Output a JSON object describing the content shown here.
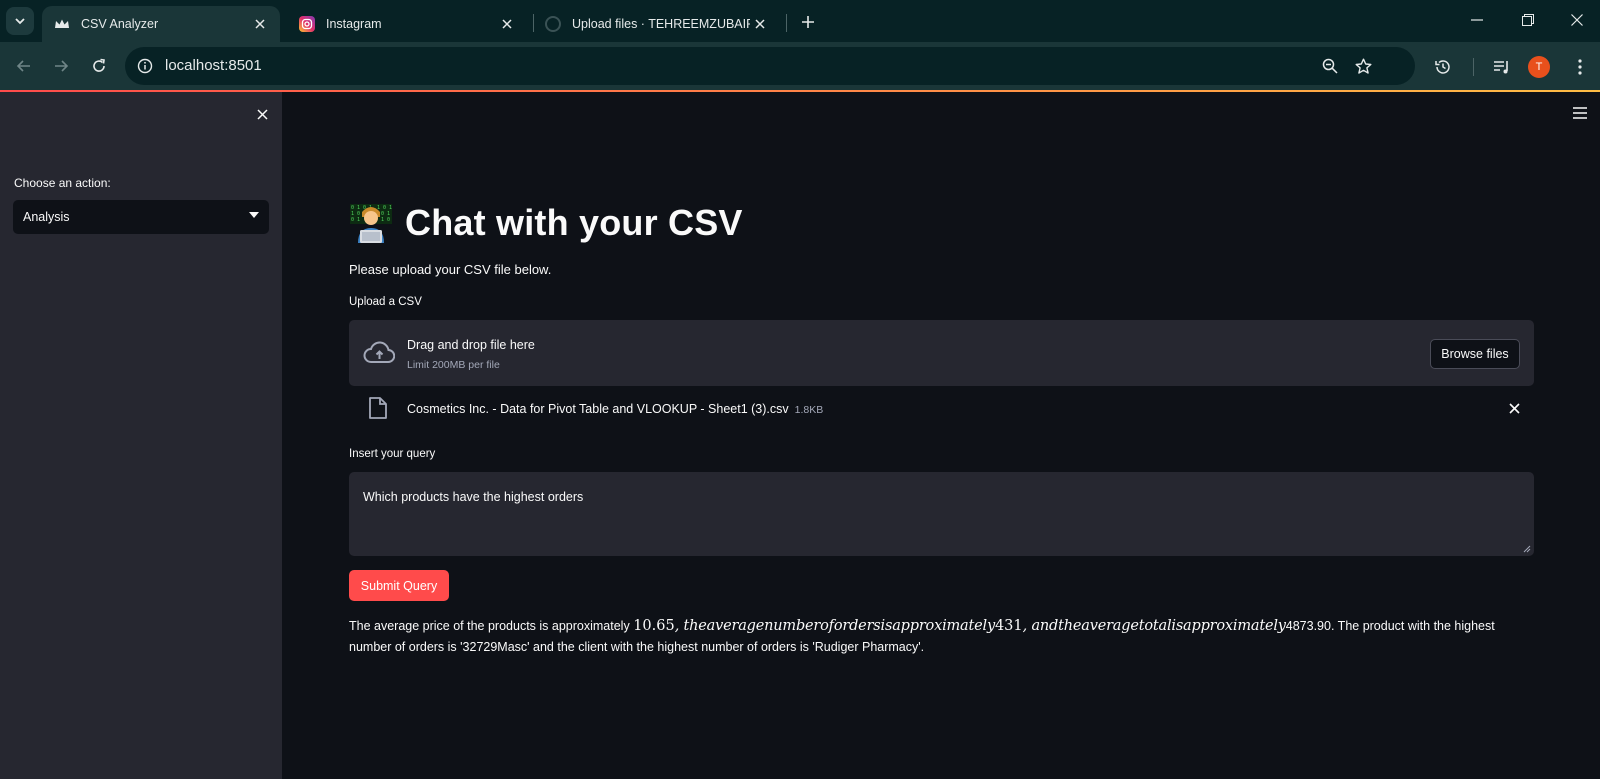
{
  "browser": {
    "tabs": [
      {
        "title": "CSV Analyzer",
        "favicon": "streamlit-crown-icon",
        "active": true
      },
      {
        "title": "Instagram",
        "favicon": "instagram-icon",
        "active": false
      },
      {
        "title": "Upload files · TEHREEMZUBAIR/Da",
        "favicon": "github-icon",
        "active": false
      }
    ],
    "url": "localhost:8501",
    "profile_initial": "T",
    "colors": {
      "frame": "#072225",
      "toolbar": "#1a3638",
      "avatar": "#e8501c"
    }
  },
  "sidebar": {
    "label": "Choose an action:",
    "select_value": "Analysis"
  },
  "main": {
    "title": "Chat with your CSV",
    "title_icon": "technologist-emoji",
    "subtitle": "Please upload your CSV file below.",
    "upload_label": "Upload a CSV",
    "dropzone": {
      "main": "Drag and drop file here",
      "sub": "Limit 200MB per file",
      "button": "Browse files"
    },
    "file": {
      "name": "Cosmetics Inc. - Data for Pivot Table and VLOOKUP - Sheet1 (3).csv",
      "size": "1.8KB"
    },
    "query_label": "Insert your query",
    "query_value": "Which products have the highest orders",
    "submit_label": "Submit Query",
    "answer": {
      "part1": "The average price of the products is approximately ",
      "num1": "10.65",
      "math1": ", theaveragenumberofordersisapproximately",
      "num2": "431",
      "math2": ", andtheaveragetotalisapproximately",
      "part2": "4873.90. The product with the highest number of orders is '32729Masc' and the client with the highest number of orders is 'Rudiger Pharmacy'."
    }
  },
  "theme": {
    "accent": "#ff4b4b",
    "background": "#0e1117",
    "secondary_bg": "#262730"
  }
}
